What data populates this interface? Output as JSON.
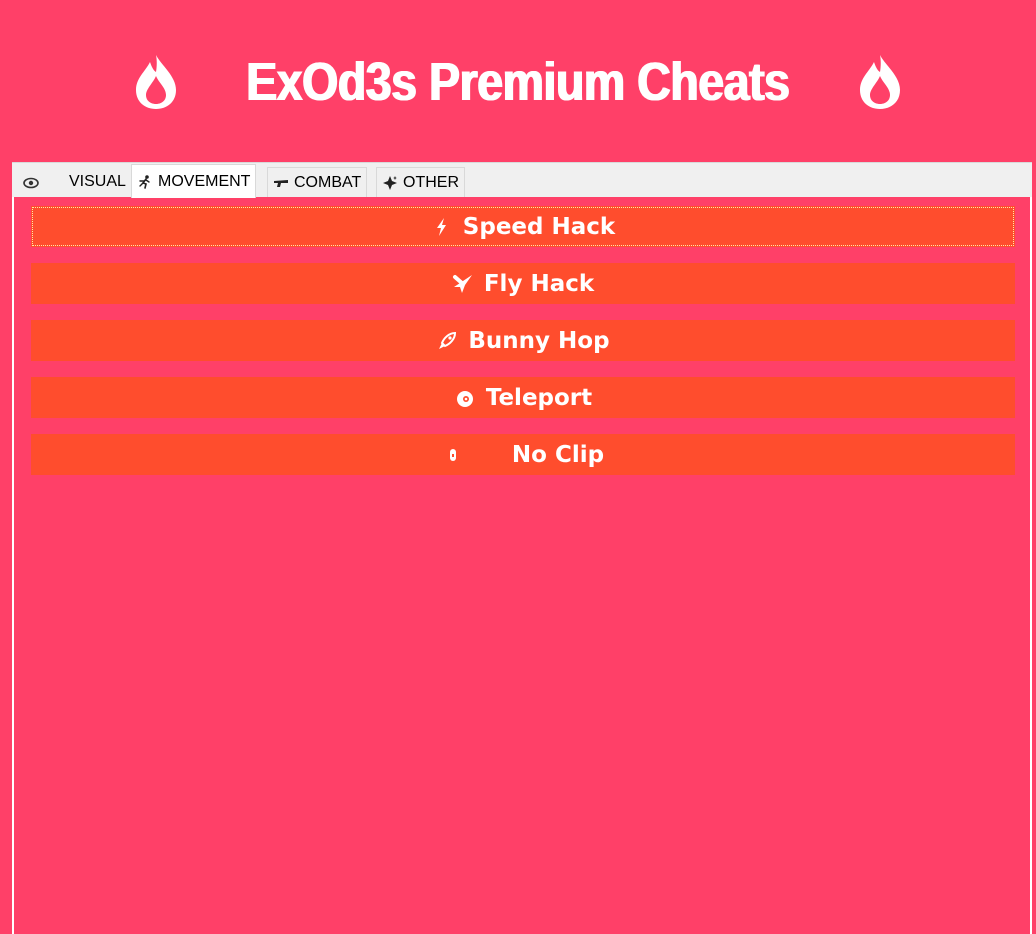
{
  "header": {
    "title": "ExOd3s Premium Cheats",
    "left_icon": "flame-icon",
    "right_icon": "flame-icon"
  },
  "tabs": [
    {
      "label": "VISUAL",
      "icon": "eye-icon",
      "active": false
    },
    {
      "label": "MOVEMENT",
      "icon": "running-icon",
      "active": true
    },
    {
      "label": "COMBAT",
      "icon": "gun-icon",
      "active": false
    },
    {
      "label": "OTHER",
      "icon": "sparkle-icon",
      "active": false
    }
  ],
  "buttons": [
    {
      "label": "Speed Hack",
      "icon": "bolt-icon",
      "focused": true
    },
    {
      "label": "Fly Hack",
      "icon": "plane-icon",
      "focused": false
    },
    {
      "label": "Bunny Hop",
      "icon": "rocket-icon",
      "focused": false
    },
    {
      "label": "Teleport",
      "icon": "portal-icon",
      "focused": false
    },
    {
      "label": "No Clip",
      "icon": "ghost-icon",
      "focused": false
    }
  ],
  "colors": {
    "background": "#ff4068",
    "button": "#ff4d2d",
    "tabbar": "#f0f0f0",
    "text_light": "#ffffff"
  }
}
